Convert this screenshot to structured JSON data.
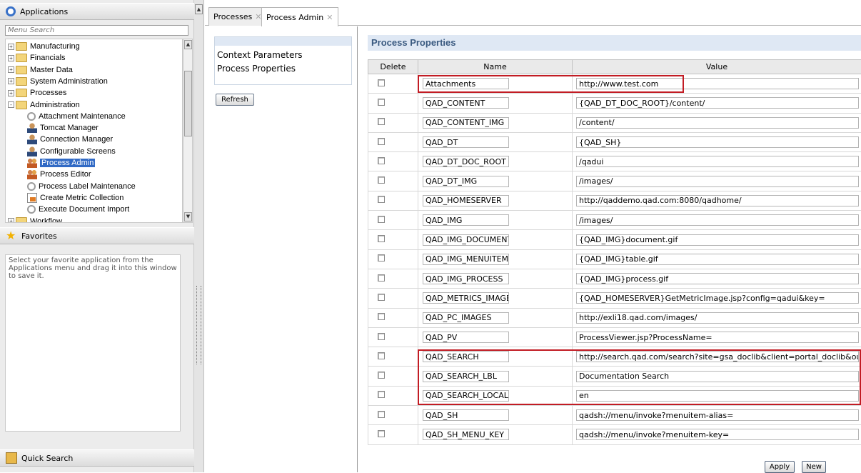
{
  "left_panel": {
    "applications_title": "Applications",
    "menu_search_placeholder": "Menu Search",
    "tree": [
      {
        "label": "Manufacturing",
        "level": 0,
        "expander": "+"
      },
      {
        "label": "Financials",
        "level": 0,
        "expander": "+"
      },
      {
        "label": "Master Data",
        "level": 0,
        "expander": "+"
      },
      {
        "label": "System Administration",
        "level": 0,
        "expander": "+"
      },
      {
        "label": "Processes",
        "level": 0,
        "expander": "+"
      },
      {
        "label": "Administration",
        "level": 0,
        "expander": "-"
      },
      {
        "label": "Attachment Maintenance",
        "level": 1,
        "icon": "gears-icon"
      },
      {
        "label": "Tomcat Manager",
        "level": 1,
        "icon": "person-icon"
      },
      {
        "label": "Connection Manager",
        "level": 1,
        "icon": "person-icon"
      },
      {
        "label": "Configurable Screens",
        "level": 1,
        "icon": "person-icon"
      },
      {
        "label": "Process Admin",
        "level": 1,
        "icon": "people-icon",
        "selected": true
      },
      {
        "label": "Process Editor",
        "level": 1,
        "icon": "people-icon"
      },
      {
        "label": "Process Label Maintenance",
        "level": 1,
        "icon": "gears-icon"
      },
      {
        "label": "Create Metric Collection",
        "level": 1,
        "icon": "document-icon"
      },
      {
        "label": "Execute Document Import",
        "level": 1,
        "icon": "gears-icon"
      },
      {
        "label": "Workflow",
        "level": 0,
        "expander": "+"
      }
    ],
    "favorites_title": "Favorites",
    "favorites_hint": "Select your favorite application from the Applications menu and drag it into this window to save it.",
    "quick_search_title": "Quick Search"
  },
  "tabs": [
    {
      "label": "Processes",
      "active": false
    },
    {
      "label": "Process Admin",
      "active": true
    }
  ],
  "context": {
    "items": [
      "Context Parameters",
      "Process Properties"
    ],
    "refresh_label": "Refresh"
  },
  "properties": {
    "title": "Process Properties",
    "columns": {
      "delete": "Delete",
      "name": "Name",
      "value": "Value"
    },
    "rows": [
      {
        "name": "Attachments",
        "value": "http://www.test.com"
      },
      {
        "name": "QAD_CONTENT",
        "value": "{QAD_DT_DOC_ROOT}/content/"
      },
      {
        "name": "QAD_CONTENT_IMG",
        "value": "/content/"
      },
      {
        "name": "QAD_DT",
        "value": "{QAD_SH}"
      },
      {
        "name": "QAD_DT_DOC_ROOT",
        "value": "/qadui"
      },
      {
        "name": "QAD_DT_IMG",
        "value": "/images/"
      },
      {
        "name": "QAD_HOMESERVER",
        "value": "http://qaddemo.qad.com:8080/qadhome/"
      },
      {
        "name": "QAD_IMG",
        "value": "/images/"
      },
      {
        "name": "QAD_IMG_DOCUMENT",
        "value": "{QAD_IMG}document.gif"
      },
      {
        "name": "QAD_IMG_MENUITEM",
        "value": "{QAD_IMG}table.gif"
      },
      {
        "name": "QAD_IMG_PROCESS",
        "value": "{QAD_IMG}process.gif"
      },
      {
        "name": "QAD_METRICS_IMAGE",
        "value": "{QAD_HOMESERVER}GetMetricImage.jsp?config=qadui&key="
      },
      {
        "name": "QAD_PC_IMAGES",
        "value": "http://exli18.qad.com/images/"
      },
      {
        "name": "QAD_PV",
        "value": "ProcessViewer.jsp?ProcessName="
      },
      {
        "name": "QAD_SEARCH",
        "value": "http://search.qad.com/search?site=gsa_doclib&client=portal_doclib&output"
      },
      {
        "name": "QAD_SEARCH_LBL",
        "value": "Documentation Search"
      },
      {
        "name": "QAD_SEARCH_LOCALE",
        "value": "en"
      },
      {
        "name": "QAD_SH",
        "value": "qadsh://menu/invoke?menuitem-alias="
      },
      {
        "name": "QAD_SH_MENU_KEY",
        "value": "qadsh://menu/invoke?menuitem-key="
      }
    ],
    "apply_label": "Apply",
    "new_label": "New"
  },
  "colors": {
    "highlight": "#c21c24",
    "selection": "#316ac5",
    "title_text": "#3a5a80"
  }
}
